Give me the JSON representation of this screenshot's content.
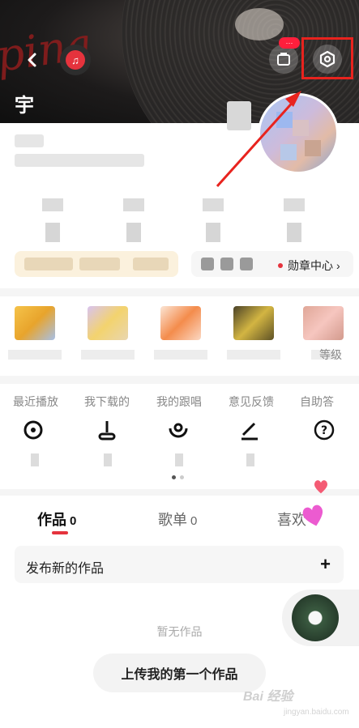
{
  "header": {
    "user_name": "宇",
    "deco_text": "pina",
    "store_badge": "···",
    "icons": {
      "back": "back-arrow-icon",
      "music": "music-note-icon",
      "store": "store-icon",
      "settings": "hexagon-settings-icon"
    }
  },
  "badges": {
    "badge_center_label": "勋章中心",
    "chevron": "›"
  },
  "apps": {
    "level_label": "等级"
  },
  "quick_menu": {
    "items": [
      "最近播放",
      "我下载的",
      "我的跟唱",
      "意见反馈",
      "自助答"
    ]
  },
  "tabs": [
    {
      "label": "作品",
      "count": "0"
    },
    {
      "label": "歌单",
      "count": "0"
    },
    {
      "label": "喜欢",
      "count": ""
    }
  ],
  "publish": {
    "label": "发布新的作品",
    "plus": "+"
  },
  "empty": {
    "text": "暂无作品"
  },
  "upload": {
    "label": "上传我的第一个作品"
  },
  "watermark": {
    "brand": "Bai 经验",
    "url": "jingyan.baidu.com"
  },
  "colors": {
    "accent": "#e5333d",
    "highlight": "#e8231e"
  }
}
